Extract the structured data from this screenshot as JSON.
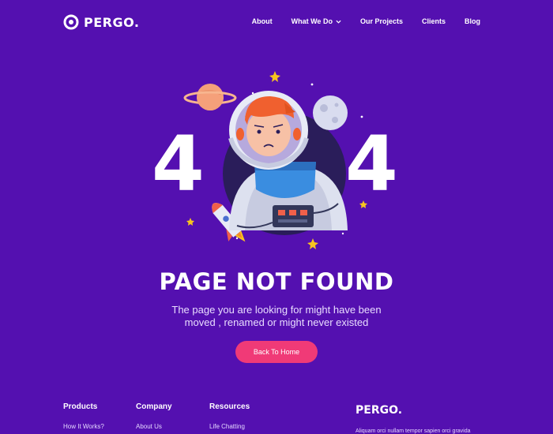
{
  "brand": {
    "name": "PERGO."
  },
  "nav": {
    "items": [
      {
        "label": "About"
      },
      {
        "label": "What We Do"
      },
      {
        "label": "Our Projects"
      },
      {
        "label": "Clients"
      },
      {
        "label": "Blog"
      }
    ]
  },
  "error": {
    "digit_left": "4",
    "digit_right": "4",
    "title": "PAGE NOT FOUND",
    "message": "The page you are looking for might have been moved , renamed or might never existed",
    "button_label": "Back To Home"
  },
  "footer": {
    "columns": [
      {
        "heading": "Products",
        "first_link": "How It Works?"
      },
      {
        "heading": "Company",
        "first_link": "About Us"
      },
      {
        "heading": "Resources",
        "first_link": "Life Chatting"
      }
    ],
    "brand": "PERGO.",
    "description": "Aliquam orci nullam tempor sapien orci gravida"
  },
  "colors": {
    "background": "#5410b0",
    "accent_button": "#f03a77",
    "text": "#ffffff"
  }
}
